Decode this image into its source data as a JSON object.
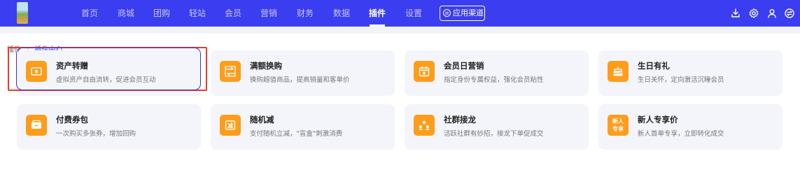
{
  "nav": {
    "items": [
      {
        "label": "首页"
      },
      {
        "label": "商城"
      },
      {
        "label": "团购"
      },
      {
        "label": "轻站"
      },
      {
        "label": "会员"
      },
      {
        "label": "营销"
      },
      {
        "label": "财务"
      },
      {
        "label": "数据"
      },
      {
        "label": "插件",
        "active": true
      },
      {
        "label": "设置"
      }
    ],
    "app_channel": "应用渠道",
    "tools": [
      "download-icon",
      "gear-icon",
      "user-icon",
      "switch-icon"
    ]
  },
  "breadcrumb": {
    "root": "插件",
    "separator": "/",
    "current": "插件中心"
  },
  "cards": [
    {
      "title": "资产转赠",
      "desc": "虚拟资产自由流转，促进会员互动",
      "icon": "transfer-icon"
    },
    {
      "title": "满额换购",
      "desc": "换购超值商品，提高销量和客单价",
      "icon": "exchange-icon"
    },
    {
      "title": "会员日营销",
      "desc": "指定身份专属权益，强化会员粘性",
      "icon": "calendar-icon"
    },
    {
      "title": "生日有礼",
      "desc": "生日关怀，定向激活沉睡会员",
      "icon": "cake-icon"
    },
    {
      "title": "付费券包",
      "desc": "一次购买多张券，增加回购",
      "icon": "coupon-pack-icon"
    },
    {
      "title": "随机减",
      "desc": "支付随机立减，\"盲盒\"刺激消费",
      "icon": "random-discount-icon"
    },
    {
      "title": "社群接龙",
      "desc": "活跃社群有妙招，接龙下单促成交",
      "icon": "group-relay-icon"
    },
    {
      "title": "新人专享价",
      "desc": "新人首单专享，立即转化成交",
      "icon": "new-user-icon",
      "icon_text": [
        "新人",
        "专享"
      ]
    }
  ],
  "colors": {
    "nav_bg": "#3b3df0",
    "icon_bg": "#ff9c1a",
    "card_bg": "#f3f5fa",
    "highlight_red": "#e8392e",
    "highlight_blue": "#3a33c8"
  }
}
